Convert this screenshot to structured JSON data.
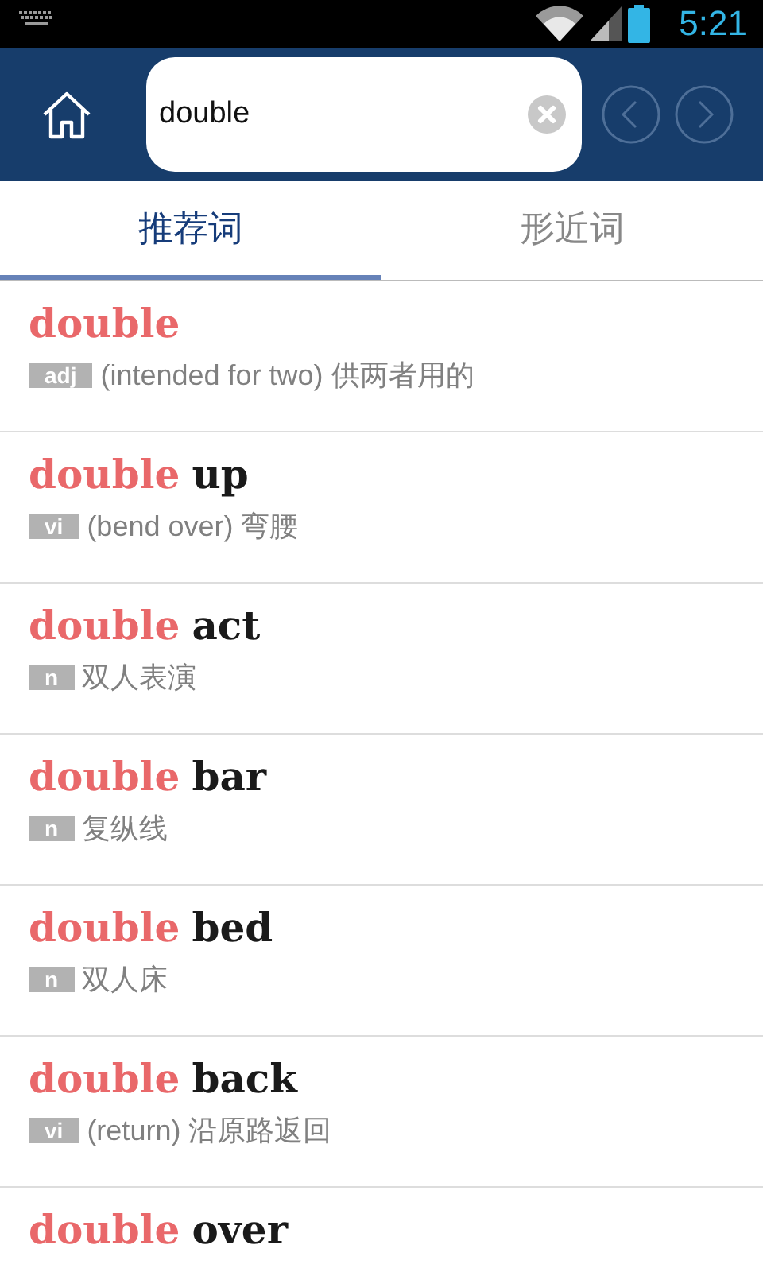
{
  "status_bar": {
    "time": "5:21"
  },
  "search": {
    "value": "double"
  },
  "tabs": [
    {
      "label": "推荐词",
      "selected": true
    },
    {
      "label": "形近词",
      "selected": false
    }
  ],
  "results": [
    {
      "match": "double",
      "pos": "adj",
      "definition": "(intended for two) 供两者用的"
    },
    {
      "match": "double",
      "rest": "up",
      "pos": "vi",
      "definition": "(bend over) 弯腰"
    },
    {
      "match": "double",
      "rest": "act",
      "pos": "n",
      "definition": "双人表演"
    },
    {
      "match": "double",
      "rest": "bar",
      "pos": "n",
      "definition": "复纵线"
    },
    {
      "match": "double",
      "rest": "bed",
      "pos": "n",
      "definition": "双人床"
    },
    {
      "match": "double",
      "rest": "back",
      "pos": "vi",
      "definition": "(return) 沿原路返回"
    },
    {
      "match": "double",
      "rest": "over"
    }
  ]
}
